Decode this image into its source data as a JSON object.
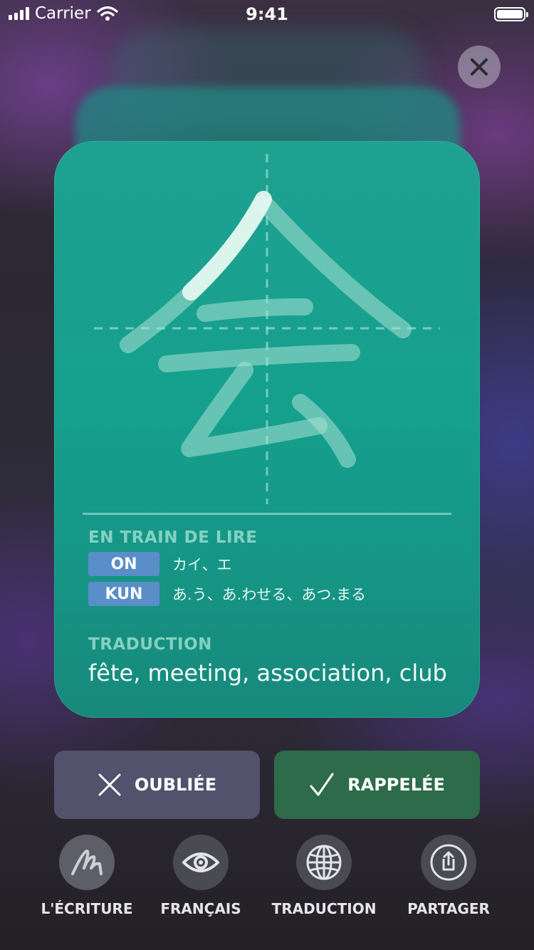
{
  "status_bar": {
    "carrier": "Carrier",
    "time": "9:41"
  },
  "card": {
    "reading_label": "EN TRAIN DE LIRE",
    "on": {
      "badge": "ON",
      "value": "カイ、エ"
    },
    "kun": {
      "badge": "KUN",
      "value": "あ.う、あ.わせる、あつ.まる"
    },
    "translation_label": "TRADUCTION",
    "translation": "fête, meeting, association, club"
  },
  "actions": {
    "forgot_label": "OUBLIÉE",
    "remember_label": "RAPPELÉE"
  },
  "toolbar": [
    {
      "label": "L'ÉCRITURE",
      "icon": "handwriting-icon"
    },
    {
      "label": "FRANÇAIS",
      "icon": "eye-icon"
    },
    {
      "label": "TRADUCTION",
      "icon": "globe-icon"
    },
    {
      "label": "PARTAGER",
      "icon": "share-icon"
    }
  ],
  "colors": {
    "card": "#14a08e",
    "forgot": "#53526c",
    "remember": "#2d6b4a",
    "badge": "#5a8ec8"
  }
}
